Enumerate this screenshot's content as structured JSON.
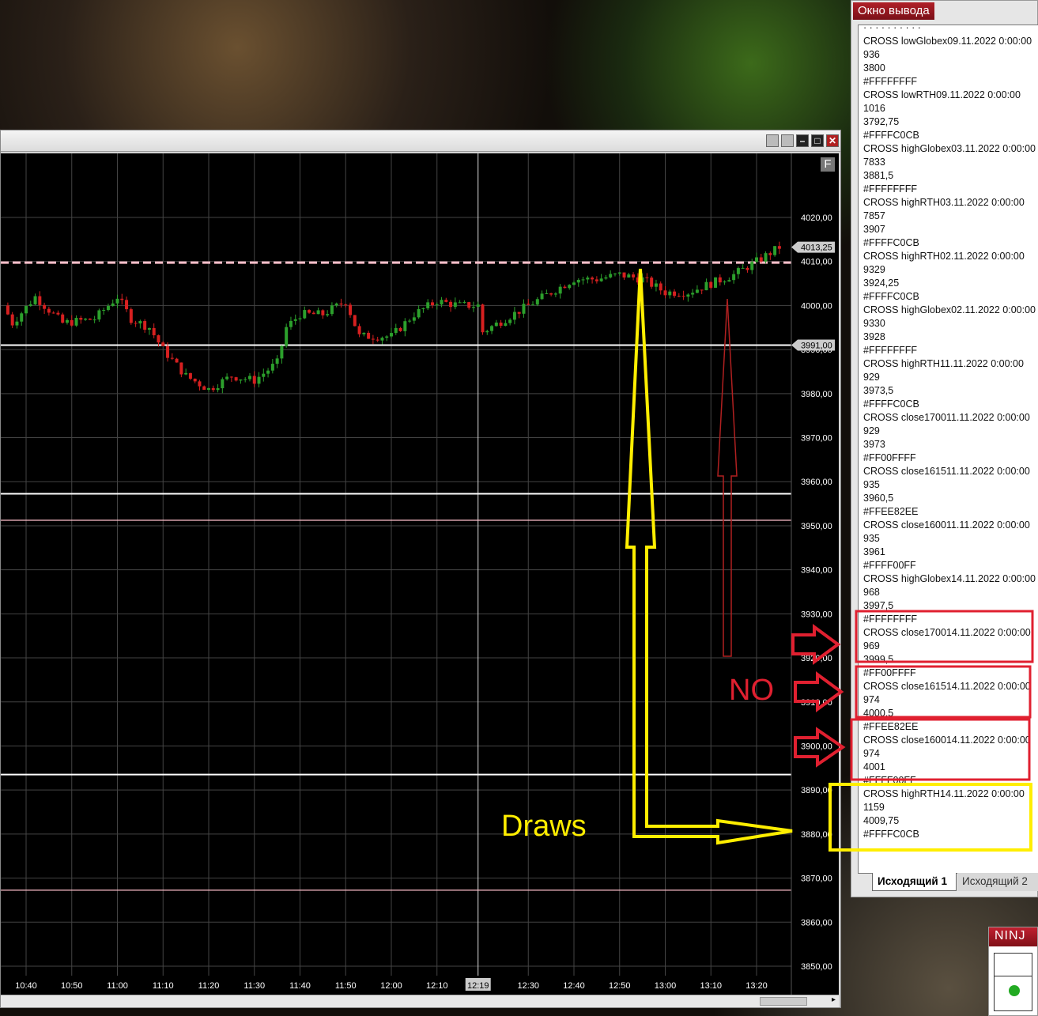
{
  "chart_window": {
    "float_button": "F",
    "current_time_label": "12:19",
    "price_label": "4013,25",
    "line_label": "3991,00"
  },
  "chart_data": {
    "type": "candlestick",
    "y_ticks": [
      "4020,00",
      "4010,00",
      "4000,00",
      "3990,00",
      "3980,00",
      "3970,00",
      "3960,00",
      "3950,00",
      "3940,00",
      "3930,00",
      "3920,00",
      "3910,00",
      "3900,00",
      "3890,00",
      "3880,00",
      "3870,00",
      "3860,00",
      "3850,00"
    ],
    "ylim": [
      3850,
      4020
    ],
    "x_ticks": [
      "10:40",
      "10:50",
      "11:00",
      "11:10",
      "11:20",
      "11:30",
      "11:40",
      "11:50",
      "12:00",
      "12:10",
      "12:19",
      "12:30",
      "12:40",
      "12:50",
      "13:00",
      "13:10",
      "13:20"
    ],
    "price_path": [
      [
        "10:35",
        4000
      ],
      [
        "10:37",
        3996
      ],
      [
        "10:42",
        4002
      ],
      [
        "10:48",
        3996
      ],
      [
        "10:55",
        3997
      ],
      [
        "11:00",
        4002
      ],
      [
        "11:03",
        3997
      ],
      [
        "11:07",
        3995
      ],
      [
        "11:10",
        3990
      ],
      [
        "11:15",
        3984
      ],
      [
        "11:20",
        3981
      ],
      [
        "11:25",
        3984
      ],
      [
        "11:30",
        3983
      ],
      [
        "11:35",
        3987
      ],
      [
        "11:37",
        3995
      ],
      [
        "11:40",
        3998
      ],
      [
        "11:45",
        3998
      ],
      [
        "11:50",
        4001
      ],
      [
        "11:53",
        3993
      ],
      [
        "12:00",
        3993
      ],
      [
        "12:05",
        3998
      ],
      [
        "12:10",
        4001
      ],
      [
        "12:15",
        4000
      ],
      [
        "12:19",
        4000
      ],
      [
        "12:20",
        3994
      ],
      [
        "12:25",
        3997
      ],
      [
        "12:30",
        4000
      ],
      [
        "12:35",
        4003
      ],
      [
        "12:40",
        4006
      ],
      [
        "12:45",
        4006
      ],
      [
        "12:50",
        4007
      ],
      [
        "12:55",
        4006
      ],
      [
        "13:00",
        4003
      ],
      [
        "13:05",
        4003
      ],
      [
        "13:10",
        4005
      ],
      [
        "13:15",
        4007
      ],
      [
        "13:20",
        4010
      ],
      [
        "13:25",
        4013.25
      ]
    ],
    "horizontal_lines": [
      {
        "price": 4009.75,
        "color": "#FFC0CB",
        "style": "dashed"
      },
      {
        "price": 3991,
        "color": "#FFFFFF"
      },
      {
        "price": 3957.25,
        "color": "#FFFFFF"
      },
      {
        "price": 3951.25,
        "color": "#FFC0CB"
      },
      {
        "price": 3893.5,
        "color": "#FFFFFF"
      },
      {
        "price": 3867.25,
        "color": "#FFC0CB"
      }
    ],
    "up_color": "#2ca02c",
    "down_color": "#d62020"
  },
  "annotations": {
    "draws": "Draws",
    "no": "NO"
  },
  "output_window": {
    "title": "Окно вывода",
    "lines": [
      "· · · · · · · · · ·",
      "CROSS  lowGlobex09.11.2022 0:00:00",
      "936",
      "3800",
      "#FFFFFFFF",
      "CROSS  lowRTH09.11.2022 0:00:00",
      "1016",
      "3792,75",
      "#FFFFC0CB",
      "CROSS  highGlobex03.11.2022 0:00:00",
      "7833",
      "3881,5",
      "#FFFFFFFF",
      "CROSS  highRTH03.11.2022 0:00:00",
      "7857",
      "3907",
      "#FFFFC0CB",
      "CROSS  highRTH02.11.2022 0:00:00",
      "9329",
      "3924,25",
      "#FFFFC0CB",
      "CROSS  highGlobex02.11.2022 0:00:00",
      "9330",
      "3928",
      "#FFFFFFFF",
      "CROSS  highRTH11.11.2022 0:00:00",
      "929",
      "3973,5",
      "#FFFFC0CB",
      "CROSS  close170011.11.2022 0:00:00",
      "929",
      "3973",
      "#FF00FFFF",
      "CROSS  close161511.11.2022 0:00:00",
      "935",
      "3960,5",
      "#FFEE82EE",
      "CROSS  close160011.11.2022 0:00:00",
      "935",
      "3961",
      "#FFFF00FF",
      "CROSS  highGlobex14.11.2022 0:00:00",
      "968",
      "3997,5",
      "#FFFFFFFF",
      "CROSS  close170014.11.2022 0:00:00",
      "969",
      "3999,5",
      "#FF00FFFF",
      "CROSS  close161514.11.2022 0:00:00",
      "974",
      "4000,5",
      "#FFEE82EE",
      "CROSS  close160014.11.2022 0:00:00",
      "974",
      "4001",
      "#FFFF00FF",
      "CROSS  highRTH14.11.2022 0:00:00",
      "1159",
      "4009,75",
      "#FFFFC0CB"
    ],
    "tabs": [
      "Исходящий 1",
      "Исходящий 2"
    ]
  },
  "ninja": {
    "title": "NINJ",
    "status_color": "#22aa22"
  }
}
